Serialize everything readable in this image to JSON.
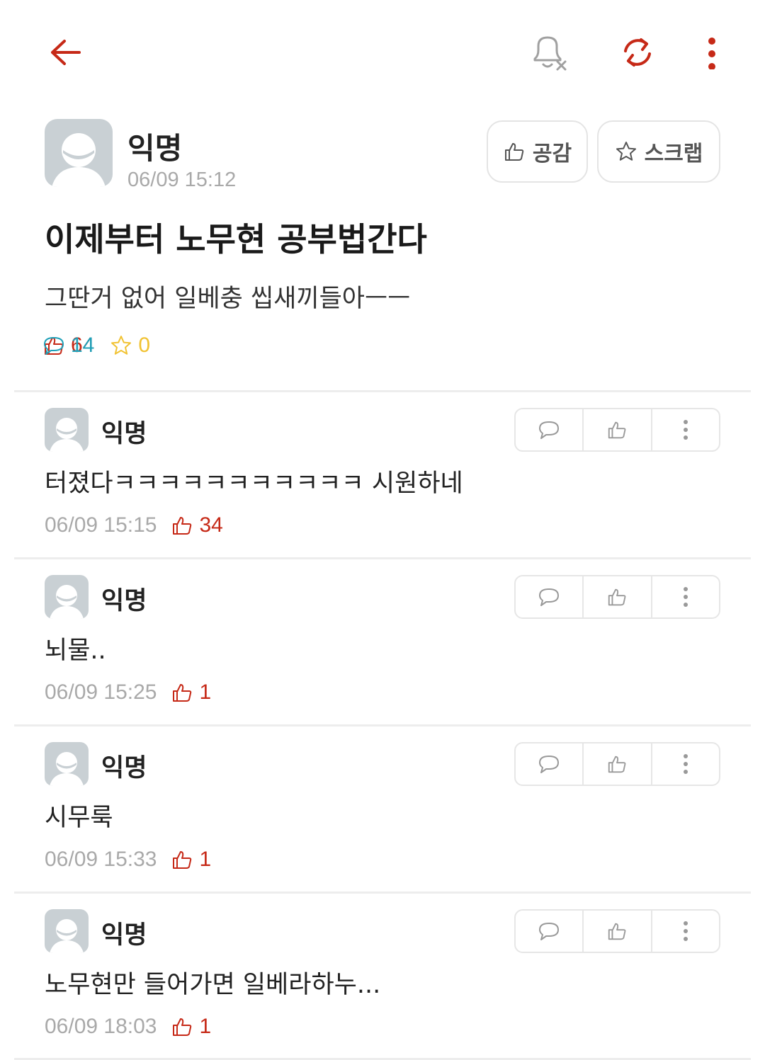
{
  "colors": {
    "accent": "#c62917",
    "comment_count": "#1fa0b8",
    "scrap_count": "#f1c232",
    "muted": "#a9a9a9",
    "divider": "#ededed"
  },
  "topbar": {
    "icons": [
      "back-arrow-icon",
      "bell-off-icon",
      "refresh-icon",
      "more-vertical-icon"
    ]
  },
  "post": {
    "author": "익명",
    "date": "06/09 15:12",
    "like_button_label": "공감",
    "scrap_button_label": "스크랩",
    "title": "이제부터 노무현 공부법간다",
    "body": "그딴거 없어 일베충 씹새끼들아ㅡㅡ",
    "stats": {
      "votes": "64",
      "comments": "14",
      "scraps": "0"
    }
  },
  "comments": [
    {
      "author": "익명",
      "text": "터졌다ㅋㅋㅋㅋㅋㅋㅋㅋㅋㅋㅋ 시원하네",
      "date": "06/09 15:15",
      "votes": "34"
    },
    {
      "author": "익명",
      "text": "뇌물..",
      "date": "06/09 15:25",
      "votes": "1"
    },
    {
      "author": "익명",
      "text": "시무룩",
      "date": "06/09 15:33",
      "votes": "1"
    },
    {
      "author": "익명",
      "text": "노무현만 들어가면 일베라하누...",
      "date": "06/09 18:03",
      "votes": "1"
    }
  ]
}
